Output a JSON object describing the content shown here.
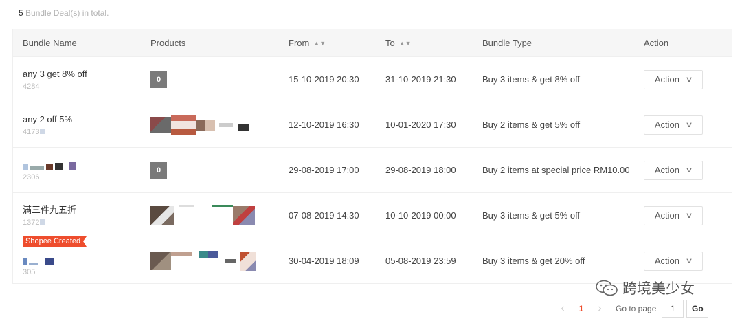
{
  "summary": {
    "count": "5",
    "text": " Bundle Deal(s) in total."
  },
  "columns": {
    "bundle_name": "Bundle Name",
    "products": "Products",
    "from": "From",
    "to": "To",
    "bundle_type": "Bundle Type",
    "action": "Action"
  },
  "sort_icon": "sort-updown-icon",
  "rows": [
    {
      "name": "any 3 get 8% off",
      "id": "4284",
      "products_count": "0",
      "from": "15-10-2019 20:30",
      "to": "31-10-2019 21:30",
      "type": "Buy 3 items & get 8% off",
      "action": "Action"
    },
    {
      "name": "any 2 off 5%",
      "id": "4173",
      "products_count": "",
      "from": "12-10-2019 16:30",
      "to": "10-01-2020 17:30",
      "type": "Buy 2 items & get 5% off",
      "action": "Action"
    },
    {
      "name": "",
      "id": "2306",
      "products_count": "0",
      "from": "29-08-2019 17:00",
      "to": "29-08-2019 18:00",
      "type": "Buy 2 items at special price RM10.00",
      "action": "Action"
    },
    {
      "name": "满三件九五折",
      "id": "1372",
      "products_count": "",
      "from": "07-08-2019 14:30",
      "to": "10-10-2019 00:00",
      "type": "Buy 3 items & get 5% off",
      "action": "Action"
    },
    {
      "name": "",
      "id": "305",
      "badge": "Shopee Created",
      "products_count": "",
      "from": "30-04-2019 18:09",
      "to": "05-08-2019 23:59",
      "type": "Buy 3 items & get 20% off",
      "action": "Action"
    }
  ],
  "pagination": {
    "current_page": "1",
    "goto_label": "Go to page",
    "input_value": "1",
    "go_label": "Go"
  },
  "watermark": {
    "text": "跨境美少女",
    "icon": "wechat-icon"
  },
  "colors": {
    "accent": "#ee4d2d",
    "header_bg": "#f6f6f6"
  }
}
